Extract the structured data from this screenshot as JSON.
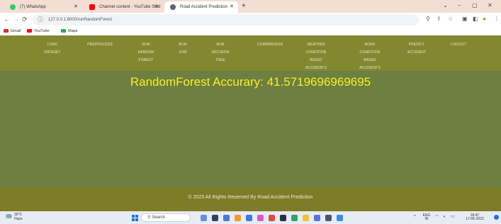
{
  "browser": {
    "tabs": [
      {
        "title": "(7) WhatsApp",
        "favicon_color": "#25d366"
      },
      {
        "title": "Channel content - YouTube Stud",
        "favicon_color": "#ff0000"
      },
      {
        "title": "Road Accident Prediction",
        "favicon_color": "#5f6368"
      }
    ],
    "new_tab": "+",
    "window_controls": [
      "⌄",
      "−",
      "▢",
      "✕"
    ],
    "url": "127.0.0.1:8000/runRandomForest",
    "bookmarks": [
      {
        "label": "Gmail",
        "color": "#d93025"
      },
      {
        "label": "YouTube",
        "color": "#ff0000"
      },
      {
        "label": "Maps",
        "color": "#34a853"
      }
    ]
  },
  "menu": {
    "items": [
      {
        "lines": [
          "LOAD",
          "DATASET"
        ]
      },
      {
        "lines": [
          "PREPROCESS"
        ]
      },
      {
        "lines": [
          "RUN",
          "RANDOM",
          "FOREST"
        ]
      },
      {
        "lines": [
          "RUN",
          "SVM"
        ]
      },
      {
        "lines": [
          "RUN",
          "DECISION",
          "TREE"
        ]
      },
      {
        "lines": [
          "COMPARISION"
        ]
      },
      {
        "lines": [
          "WEATHER",
          "CONDITION",
          "BASED",
          "ACCIDENTS"
        ]
      },
      {
        "lines": [
          "ROAD",
          "CONDITION",
          "BASED",
          "ACCIDENTS"
        ]
      },
      {
        "lines": [
          "PREDICT",
          "ACCIDENT"
        ]
      },
      {
        "lines": [
          "LOGOUT"
        ]
      }
    ]
  },
  "result": {
    "text": "RandomForest Accurary: 41.5719696969695"
  },
  "footer": {
    "text": "© 2023 All Rights Reserved By Road Accident Prediction"
  },
  "taskbar": {
    "weather": {
      "temp": "30°C",
      "condition": "Haze"
    },
    "search_placeholder": "Search",
    "tray": {
      "lang": "ENG\nIN",
      "time": "18:47",
      "date": "17-06-2023"
    }
  },
  "colors": {
    "menu_bg": "#83872f",
    "content_bg": "#6e7f42",
    "result_text": "#f6f11e",
    "footer_bg": "#7e7c27"
  }
}
